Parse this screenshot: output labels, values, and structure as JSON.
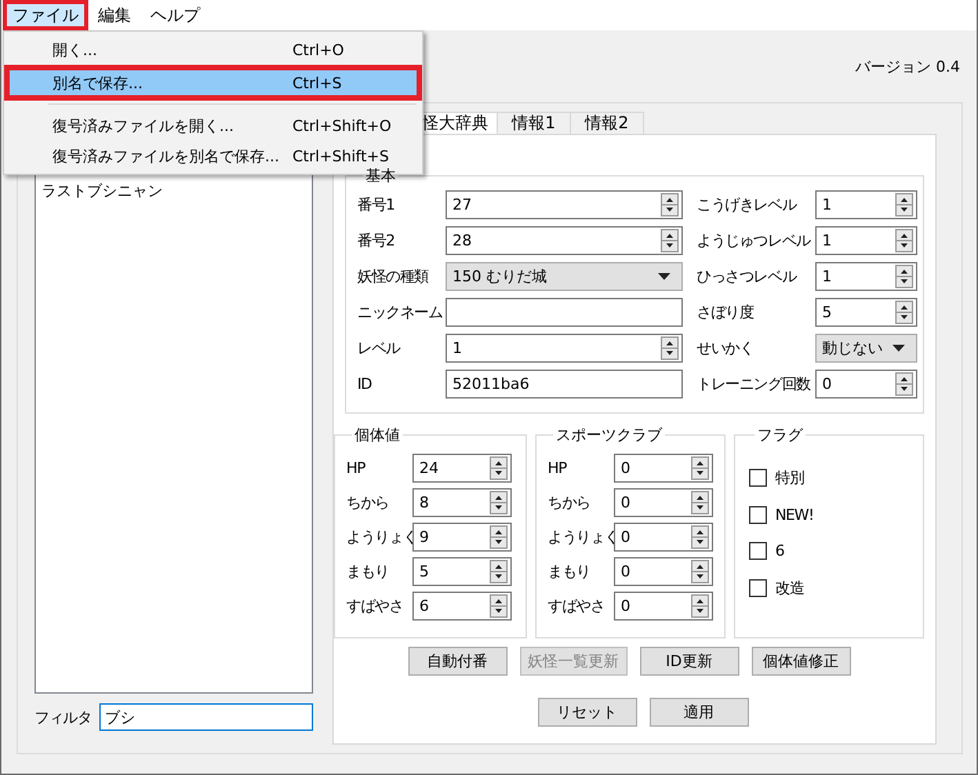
{
  "menubar": [
    {
      "label": "ファイル",
      "selected": true,
      "annotated": true
    },
    {
      "label": "編集",
      "selected": false,
      "annotated": false
    },
    {
      "label": "ヘルプ",
      "selected": false,
      "annotated": false
    }
  ],
  "menu": {
    "groups": [
      [
        {
          "label": "開く...",
          "shortcut": "Ctrl+O",
          "selected": false,
          "annotated": false
        },
        {
          "label": "別名で保存...",
          "shortcut": "Ctrl+S",
          "selected": true,
          "annotated": true
        }
      ],
      [
        {
          "label": "復号済みファイルを開く...",
          "shortcut": "Ctrl+Shift+O",
          "selected": false,
          "annotated": false
        },
        {
          "label": "復号済みファイルを別名で保存...",
          "shortcut": "Ctrl+Shift+S",
          "selected": false,
          "annotated": false
        }
      ]
    ]
  },
  "version": "バージョン 0.4",
  "list": {
    "items": [
      {
        "label": "ラストブシニャン",
        "selected": false
      }
    ]
  },
  "filter": {
    "label": "フィルタ",
    "value": "ブシ"
  },
  "tabs": [
    {
      "label": "怪大辞典",
      "selected": true
    },
    {
      "label": "情報1",
      "selected": false
    },
    {
      "label": "情報2",
      "selected": false
    }
  ],
  "basic": {
    "title": "基本",
    "rows": [
      {
        "left": {
          "label": "番号1",
          "kind": "spin",
          "value": "27"
        },
        "right": {
          "label": "こうげきレベル",
          "kind": "spin",
          "value": "1"
        }
      },
      {
        "left": {
          "label": "番号2",
          "kind": "spin",
          "value": "28"
        },
        "right": {
          "label": "ようじゅつレベル",
          "kind": "spin",
          "value": "1"
        }
      },
      {
        "left": {
          "label": "妖怪の種類",
          "kind": "combo",
          "value": "150 むりだ城"
        },
        "right": {
          "label": "ひっさつレベル",
          "kind": "spin",
          "value": "1"
        }
      },
      {
        "left": {
          "label": "ニックネーム",
          "kind": "text"
        },
        "right": {
          "label": "さぼり度",
          "kind": "spin",
          "value": "5"
        }
      },
      {
        "left": {
          "label": "レベル",
          "kind": "spin",
          "value": "1"
        },
        "right": {
          "label": "せいかく",
          "kind": "combo",
          "value": "動じない"
        }
      },
      {
        "left": {
          "label": "ID",
          "kind": "text",
          "value": "52011ba6"
        },
        "right": {
          "label": "トレーニング回数",
          "kind": "spin",
          "value": "0"
        }
      }
    ]
  },
  "stat_groups": [
    {
      "title": "個体値",
      "rows": [
        {
          "label": "HP",
          "value": "24"
        },
        {
          "label": "ちから",
          "value": "8"
        },
        {
          "label": "ようりょく",
          "value": "9"
        },
        {
          "label": "まもり",
          "value": "5"
        },
        {
          "label": "すばやさ",
          "value": "6"
        }
      ]
    },
    {
      "title": "スポーツクラブ",
      "rows": [
        {
          "label": "HP",
          "value": "0"
        },
        {
          "label": "ちから",
          "value": "0"
        },
        {
          "label": "ようりょく",
          "value": "0"
        },
        {
          "label": "まもり",
          "value": "0"
        },
        {
          "label": "すばやさ",
          "value": "0"
        }
      ]
    }
  ],
  "flags": {
    "title": "フラグ",
    "items": [
      {
        "label": "特別",
        "checked": false
      },
      {
        "label": "NEW!",
        "checked": false
      },
      {
        "label": "6",
        "checked": false
      },
      {
        "label": "改造",
        "checked": false
      }
    ]
  },
  "action_buttons": [
    {
      "label": "自動付番",
      "disabled": false
    },
    {
      "label": "妖怪一覧更新",
      "disabled": true
    },
    {
      "label": "ID更新",
      "disabled": false
    },
    {
      "label": "個体値修正",
      "disabled": false
    }
  ],
  "bottom_buttons": [
    {
      "label": "リセット",
      "disabled": false
    },
    {
      "label": "適用",
      "disabled": false
    }
  ]
}
